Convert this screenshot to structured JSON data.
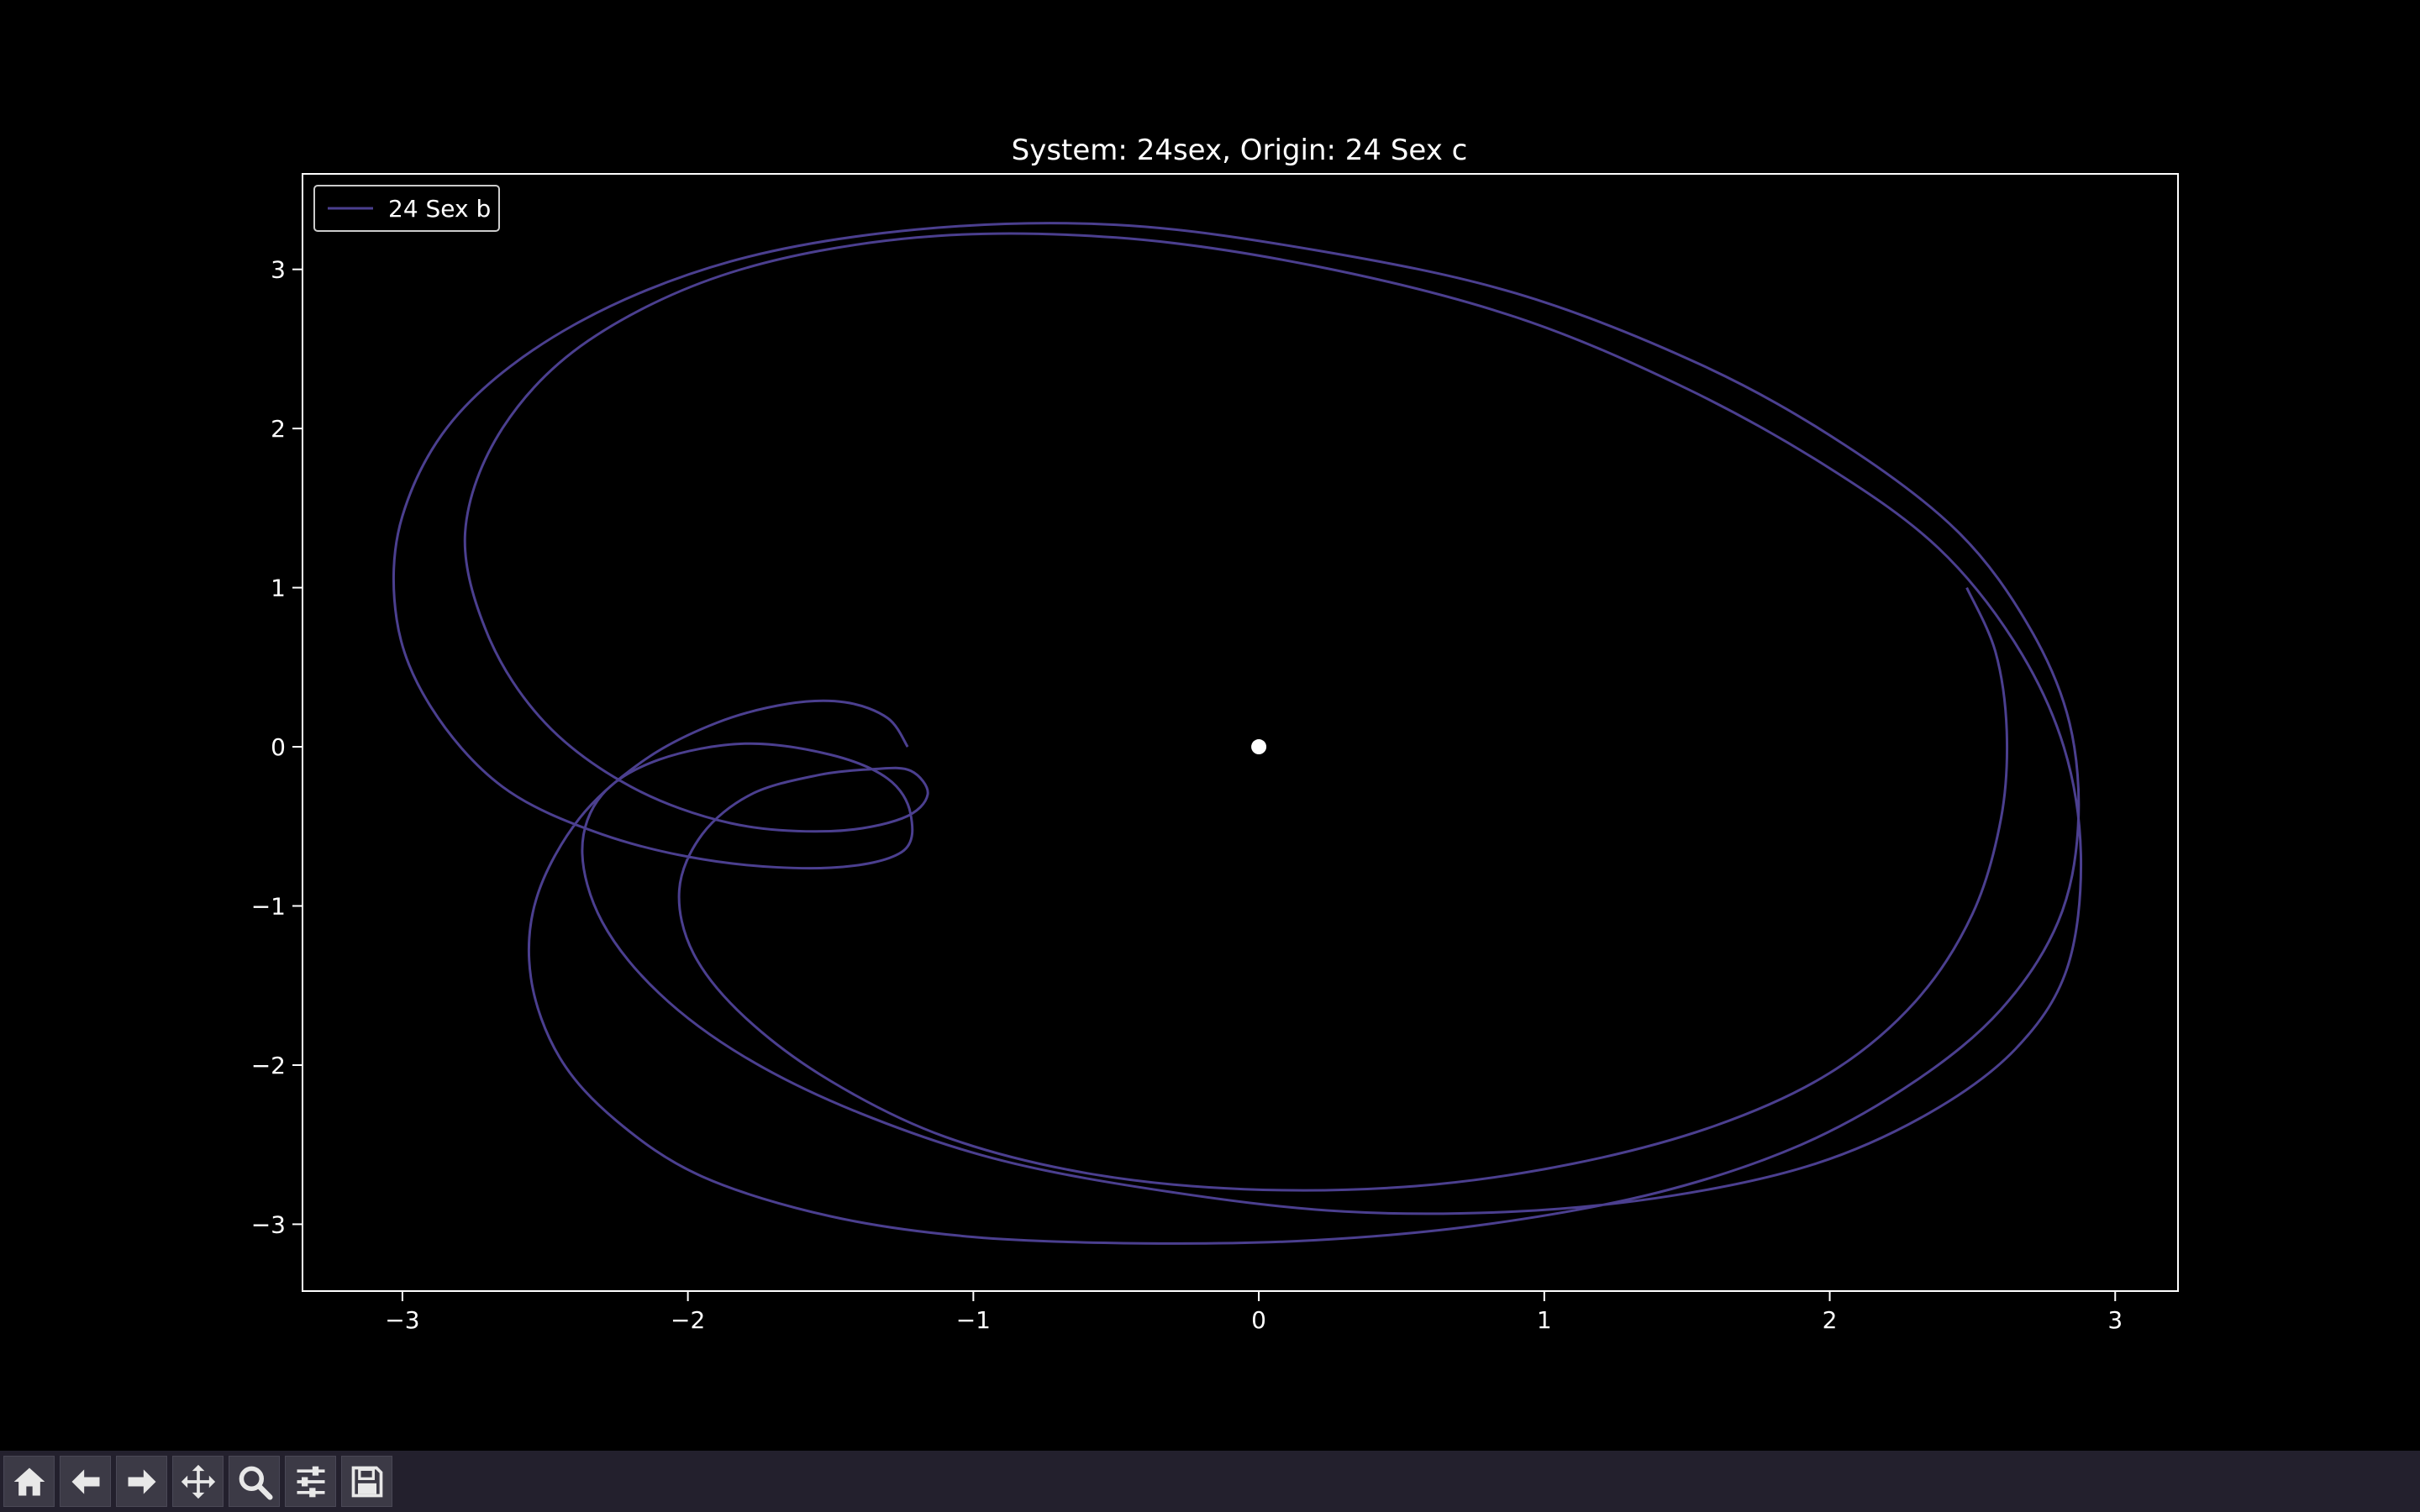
{
  "chart_data": {
    "type": "line",
    "title": "System: 24sex, Origin: 24 Sex c",
    "xlabel": "",
    "ylabel": "",
    "xlim": [
      -3.35,
      3.22
    ],
    "ylim": [
      -3.42,
      3.6
    ],
    "xticks": [
      -3,
      -2,
      -1,
      0,
      1,
      2,
      3
    ],
    "yticks": [
      -3,
      -2,
      -1,
      0,
      1,
      2,
      3
    ],
    "xtick_labels": [
      "−3",
      "−2",
      "−1",
      "0",
      "1",
      "2",
      "3"
    ],
    "ytick_labels": [
      "−3",
      "−2",
      "−1",
      "0",
      "1",
      "2",
      "3"
    ],
    "grid": false,
    "legend_position": "upper left",
    "background": "#000000",
    "foreground": "#ffffff",
    "series": [
      {
        "name": "24 Sex b",
        "color": "#4b3f8f",
        "x": [
          -1.23,
          -1.3,
          -1.45,
          -1.65,
          -1.9,
          -2.15,
          -2.38,
          -2.53,
          -2.55,
          -2.45,
          -2.25,
          -1.95,
          -1.5,
          -1.0,
          -0.4,
          0.2,
          0.8,
          1.4,
          1.9,
          2.3,
          2.6,
          2.8,
          2.87,
          2.84,
          2.7,
          2.45,
          2.05,
          1.55,
          0.9,
          0.2,
          -0.5,
          -1.2,
          -1.85,
          -2.4,
          -2.8,
          -3.0,
          -3.02,
          -2.9,
          -2.65,
          -2.3,
          -1.9,
          -1.5,
          -1.25,
          -1.22,
          -1.3,
          -1.5,
          -1.8,
          -2.1,
          -2.3,
          -2.37,
          -2.3,
          -2.1,
          -1.8,
          -1.4,
          -0.9,
          -0.3,
          0.3,
          0.9,
          1.45,
          1.95,
          2.35,
          2.65,
          2.83,
          2.88,
          2.82,
          2.65,
          2.38,
          2.0,
          1.5,
          0.9,
          0.2,
          -0.5,
          -1.2,
          -1.85,
          -2.35,
          -2.65,
          -2.78,
          -2.7,
          -2.5,
          -2.2,
          -1.85,
          -1.5,
          -1.25,
          -1.16,
          -1.22,
          -1.35,
          -1.55,
          -1.78,
          -1.95,
          -2.03,
          -1.98,
          -1.8,
          -1.5,
          -1.1,
          -0.6,
          -0.05,
          0.55,
          1.1,
          1.6,
          2.0,
          2.3,
          2.5,
          2.6,
          2.62,
          2.58,
          2.48
        ],
        "y": [
          0.0,
          0.18,
          0.28,
          0.27,
          0.15,
          -0.08,
          -0.45,
          -0.95,
          -1.45,
          -1.95,
          -2.35,
          -2.7,
          -2.95,
          -3.08,
          -3.12,
          -3.1,
          -3.0,
          -2.8,
          -2.5,
          -2.1,
          -1.65,
          -1.1,
          -0.5,
          0.15,
          0.75,
          1.35,
          1.9,
          2.4,
          2.85,
          3.12,
          3.28,
          3.25,
          3.05,
          2.65,
          2.1,
          1.45,
          0.8,
          0.25,
          -0.25,
          -0.55,
          -0.72,
          -0.76,
          -0.66,
          -0.42,
          -0.2,
          -0.05,
          0.02,
          -0.08,
          -0.3,
          -0.65,
          -1.1,
          -1.55,
          -1.95,
          -2.3,
          -2.6,
          -2.8,
          -2.92,
          -2.92,
          -2.82,
          -2.62,
          -2.3,
          -1.9,
          -1.4,
          -0.7,
          0.0,
          0.65,
          1.25,
          1.75,
          2.25,
          2.7,
          3.02,
          3.2,
          3.2,
          2.98,
          2.55,
          2.0,
          1.35,
          0.7,
          0.15,
          -0.25,
          -0.48,
          -0.53,
          -0.45,
          -0.3,
          -0.15,
          -0.14,
          -0.18,
          -0.3,
          -0.55,
          -0.9,
          -1.3,
          -1.7,
          -2.1,
          -2.45,
          -2.68,
          -2.78,
          -2.76,
          -2.62,
          -2.38,
          -2.05,
          -1.6,
          -1.05,
          -0.45,
          0.1,
          0.6,
          1.0
        ]
      }
    ],
    "points": [
      {
        "x": 0,
        "y": 0,
        "color": "#ffffff"
      }
    ]
  },
  "toolbar": {
    "buttons": [
      {
        "id": "home",
        "icon": "home-icon"
      },
      {
        "id": "back",
        "icon": "arrow-left-icon"
      },
      {
        "id": "forward",
        "icon": "arrow-right-icon"
      },
      {
        "id": "pan",
        "icon": "move-icon"
      },
      {
        "id": "zoom",
        "icon": "magnifier-icon"
      },
      {
        "id": "configure",
        "icon": "sliders-icon"
      },
      {
        "id": "save",
        "icon": "floppy-disk-icon"
      }
    ],
    "bg_color": "#23202d"
  }
}
